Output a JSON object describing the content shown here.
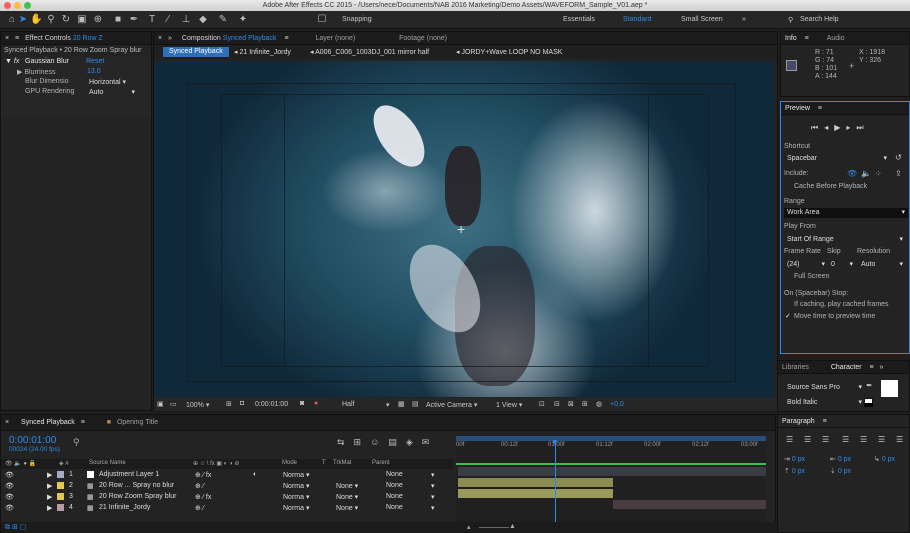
{
  "app": {
    "title": "Adobe After Effects CC 2015 - /Users/nece/Documents/NAB 2016 Marketing/Demo Assets/WAVEFORM_Sample_V01.aep *"
  },
  "toolbar": {
    "snapping": "Snapping",
    "workspaces": [
      "Essentials",
      "Standard",
      "Small Screen"
    ],
    "active_workspace": "Standard",
    "search": "Search Help"
  },
  "effect_controls": {
    "tab": "Effect Controls",
    "tab_target": "20 Row Z",
    "header": "Synced Playback • 20 Row Zoom Spray blur",
    "effect": "Gaussian Blur",
    "reset": "Reset",
    "props": [
      {
        "label": "Blurriness",
        "value": "13.0"
      },
      {
        "label": "Blur Dimensio",
        "value": "Horizontal"
      },
      {
        "label": "GPU Rendering",
        "value": "Auto"
      }
    ]
  },
  "composition": {
    "tab": "Composition",
    "tab_target": "Synced Playback",
    "layer_tab": "Layer (none)",
    "footage_tab": "Footage (none)",
    "breadcrumbs": [
      "Synced Playback",
      "21 Infinite_Jordy",
      "A006_C006_1003DJ_001 mirror half",
      "JORDY+Wave LOOP NO MASK"
    ],
    "bottom": {
      "zoom": "100%",
      "timecode": "0:00:01:00",
      "resolution": "Half",
      "camera": "Active Camera",
      "view": "1 View",
      "exposure": "+0.0"
    }
  },
  "info": {
    "tab": "Info",
    "audio_tab": "Audio",
    "R": "R : 71",
    "G": "G : 74",
    "B": "B : 101",
    "A": "A : 144",
    "X": "X : 1918",
    "Y": "Y : 326",
    "swatch": "#474a65"
  },
  "preview": {
    "tab": "Preview",
    "shortcut_label": "Shortcut",
    "shortcut": "Spacebar",
    "include": "Include:",
    "cache": "Cache Before Playback",
    "range_label": "Range",
    "range": "Work Area",
    "play_from_label": "Play From",
    "play_from": "Start Of Range",
    "frame_rate_label": "Frame Rate",
    "skip_label": "Skip",
    "resolution_label": "Resolution",
    "frame_rate": "(24)",
    "skip": "0",
    "resolution": "Auto",
    "full_screen": "Full Screen",
    "on_stop": "On (Spacebar) Stop:",
    "if_caching": "If caching, play cached frames",
    "move_time": "Move time to preview time"
  },
  "character": {
    "libraries_tab": "Libraries",
    "tab": "Character",
    "font": "Source Sans Pro",
    "style": "Bold Italic"
  },
  "paragraph": {
    "tab": "Paragraph",
    "px": [
      "0 px",
      "0 px",
      "0 px",
      "0 px",
      "0 px"
    ]
  },
  "timeline": {
    "tab": "Synced Playback",
    "tab2": "Opening Title",
    "timecode": "0:00:01:00",
    "fps": "00024 (24.00 fps)",
    "headers": {
      "source": "Source Name",
      "mode": "Mode",
      "t": "T",
      "trkmat": "TrkMat",
      "parent": "Parent"
    },
    "ruler": [
      "00f",
      "00:12f",
      "01:00f",
      "01:12f",
      "02:00f",
      "02:12f",
      "03:00f"
    ],
    "layers": [
      {
        "num": "1",
        "name": "Adjustment Layer 1",
        "mode": "Norma",
        "trkmat": "",
        "parent": "None",
        "color": "#a9a9c8"
      },
      {
        "num": "2",
        "name": "20 Row ... Spray no blur",
        "mode": "Norma",
        "trkmat": "None",
        "parent": "None",
        "color": "#e3c752"
      },
      {
        "num": "3",
        "name": "20 Row Zoom Spray blur",
        "mode": "Norma",
        "trkmat": "None",
        "parent": "None",
        "color": "#e3c752"
      },
      {
        "num": "4",
        "name": "21 Infinite_Jordy",
        "mode": "Norma",
        "trkmat": "None",
        "parent": "None",
        "color": "#b89ba6"
      }
    ]
  }
}
